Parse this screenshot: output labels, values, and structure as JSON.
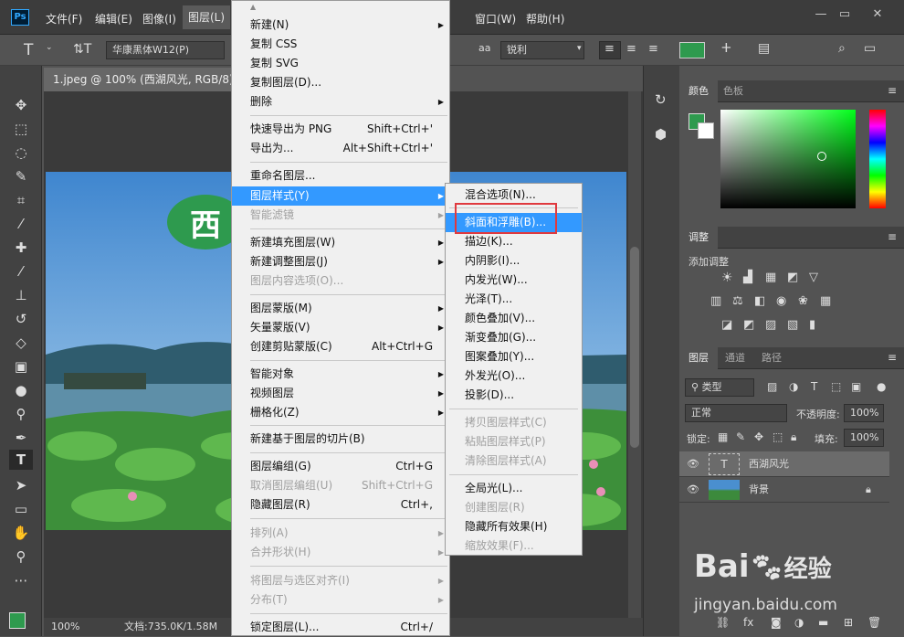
{
  "menubar": {
    "items": [
      "文件(F)",
      "编辑(E)",
      "图像(I)",
      "图层(L)",
      "窗口(W)",
      "帮助(H)"
    ],
    "logo": "Ps"
  },
  "options": {
    "font_family": "华康黑体W12(P)",
    "antialias_icon": "aa",
    "antialias": "锐利",
    "text_color": "#2e9a4e"
  },
  "document": {
    "tab": "1.jpeg @ 100% (西湖风光, RGB/8) *",
    "zoom": "100%",
    "doc_info": "文档:735.0K/1.58M",
    "title_text": "西"
  },
  "color_panel": {
    "tabs": [
      "颜色",
      "色板"
    ]
  },
  "adjust_panel": {
    "title": "调整",
    "add": "添加调整"
  },
  "layers_panel": {
    "tabs": [
      "图层",
      "通道",
      "路径"
    ],
    "kind": "类型",
    "blend": "正常",
    "opacity_label": "不透明度:",
    "opacity": "100%",
    "lock_label": "锁定:",
    "fill_label": "填充:",
    "fill": "100%",
    "layers": [
      {
        "name": "西湖风光"
      },
      {
        "name": "背景"
      }
    ]
  },
  "layer_menu": {
    "items": [
      {
        "label": "新建(N)",
        "shortcut": "",
        "submenu": true,
        "disabled": false
      },
      {
        "label": "复制 CSS",
        "shortcut": "",
        "submenu": false,
        "disabled": false
      },
      {
        "label": "复制 SVG",
        "shortcut": "",
        "submenu": false,
        "disabled": false
      },
      {
        "label": "复制图层(D)...",
        "shortcut": "",
        "submenu": false,
        "disabled": false
      },
      {
        "label": "删除",
        "shortcut": "",
        "submenu": true,
        "disabled": false
      },
      {
        "label": "快速导出为 PNG",
        "shortcut": "Shift+Ctrl+'",
        "submenu": false,
        "disabled": false
      },
      {
        "label": "导出为...",
        "shortcut": "Alt+Shift+Ctrl+'",
        "submenu": false,
        "disabled": false
      },
      {
        "label": "重命名图层...",
        "shortcut": "",
        "submenu": false,
        "disabled": false
      },
      {
        "label": "图层样式(Y)",
        "shortcut": "",
        "submenu": true,
        "disabled": false
      },
      {
        "label": "智能滤镜",
        "shortcut": "",
        "submenu": true,
        "disabled": true
      },
      {
        "label": "新建填充图层(W)",
        "shortcut": "",
        "submenu": true,
        "disabled": false
      },
      {
        "label": "新建调整图层(J)",
        "shortcut": "",
        "submenu": true,
        "disabled": false
      },
      {
        "label": "图层内容选项(O)...",
        "shortcut": "",
        "submenu": false,
        "disabled": true
      },
      {
        "label": "图层蒙版(M)",
        "shortcut": "",
        "submenu": true,
        "disabled": false
      },
      {
        "label": "矢量蒙版(V)",
        "shortcut": "",
        "submenu": true,
        "disabled": false
      },
      {
        "label": "创建剪贴蒙版(C)",
        "shortcut": "Alt+Ctrl+G",
        "submenu": false,
        "disabled": false
      },
      {
        "label": "智能对象",
        "shortcut": "",
        "submenu": true,
        "disabled": false
      },
      {
        "label": "视频图层",
        "shortcut": "",
        "submenu": true,
        "disabled": false
      },
      {
        "label": "栅格化(Z)",
        "shortcut": "",
        "submenu": true,
        "disabled": false
      },
      {
        "label": "新建基于图层的切片(B)",
        "shortcut": "",
        "submenu": false,
        "disabled": false
      },
      {
        "label": "图层编组(G)",
        "shortcut": "Ctrl+G",
        "submenu": false,
        "disabled": false
      },
      {
        "label": "取消图层编组(U)",
        "shortcut": "Shift+Ctrl+G",
        "submenu": false,
        "disabled": true
      },
      {
        "label": "隐藏图层(R)",
        "shortcut": "Ctrl+,",
        "submenu": false,
        "disabled": false
      },
      {
        "label": "排列(A)",
        "shortcut": "",
        "submenu": true,
        "disabled": true
      },
      {
        "label": "合并形状(H)",
        "shortcut": "",
        "submenu": true,
        "disabled": true
      },
      {
        "label": "将图层与选区对齐(I)",
        "shortcut": "",
        "submenu": true,
        "disabled": true
      },
      {
        "label": "分布(T)",
        "shortcut": "",
        "submenu": true,
        "disabled": true
      },
      {
        "label": "锁定图层(L)...",
        "shortcut": "Ctrl+/",
        "submenu": false,
        "disabled": false
      }
    ]
  },
  "style_submenu": {
    "items": [
      {
        "label": "混合选项(N)...",
        "disabled": false
      },
      {
        "label": "斜面和浮雕(B)...",
        "disabled": false
      },
      {
        "label": "描边(K)...",
        "disabled": false
      },
      {
        "label": "内阴影(I)...",
        "disabled": false
      },
      {
        "label": "内发光(W)...",
        "disabled": false
      },
      {
        "label": "光泽(T)...",
        "disabled": false
      },
      {
        "label": "颜色叠加(V)...",
        "disabled": false
      },
      {
        "label": "渐变叠加(G)...",
        "disabled": false
      },
      {
        "label": "图案叠加(Y)...",
        "disabled": false
      },
      {
        "label": "外发光(O)...",
        "disabled": false
      },
      {
        "label": "投影(D)...",
        "disabled": false
      },
      {
        "label": "拷贝图层样式(C)",
        "disabled": true
      },
      {
        "label": "粘贴图层样式(P)",
        "disabled": true
      },
      {
        "label": "清除图层样式(A)",
        "disabled": true
      },
      {
        "label": "全局光(L)...",
        "disabled": false
      },
      {
        "label": "创建图层(R)",
        "disabled": true
      },
      {
        "label": "隐藏所有效果(H)",
        "disabled": false
      },
      {
        "label": "缩放效果(F)...",
        "disabled": true
      }
    ]
  },
  "watermark": {
    "brand": "Bai",
    "brand2": "经验",
    "url": "jingyan.baidu.com"
  }
}
